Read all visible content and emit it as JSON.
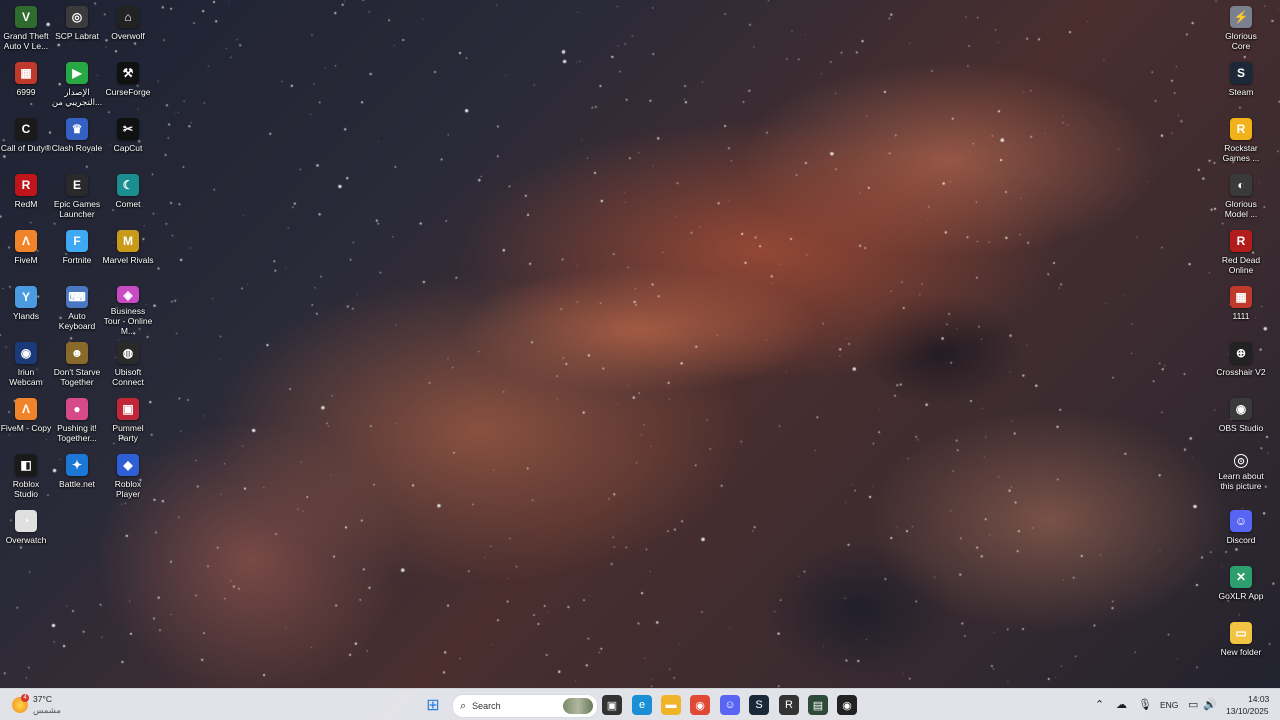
{
  "desktop": {
    "left_icons": [
      {
        "label": "Grand Theft Auto V Le...",
        "glyph": "V",
        "color": "#2f6b2f"
      },
      {
        "label": "SCP Labrat",
        "glyph": "◎",
        "color": "#3b3b3b"
      },
      {
        "label": "Overwolf",
        "glyph": "⌂",
        "color": "#222222"
      },
      {
        "label": "6999",
        "glyph": "▦",
        "color": "#c0392b"
      },
      {
        "label": "الإصدار التجريبي من...",
        "glyph": "▶",
        "color": "#27a844"
      },
      {
        "label": "CurseForge",
        "glyph": "⚒",
        "color": "#111111"
      },
      {
        "label": "Call of Duty®",
        "glyph": "C",
        "color": "#1a1a1a"
      },
      {
        "label": "Clash Royale",
        "glyph": "♛",
        "color": "#3460c4"
      },
      {
        "label": "CapCut",
        "glyph": "✂",
        "color": "#111111"
      },
      {
        "label": "RedM",
        "glyph": "R",
        "color": "#c0161b"
      },
      {
        "label": "Epic Games Launcher",
        "glyph": "E",
        "color": "#2a2a2a"
      },
      {
        "label": "Comet",
        "glyph": "☾",
        "color": "#1b8f8f"
      },
      {
        "label": "FiveM",
        "glyph": "Λ",
        "color": "#f0842a"
      },
      {
        "label": "Fortnite",
        "glyph": "F",
        "color": "#3fa9f5"
      },
      {
        "label": "Marvel Rivals",
        "glyph": "M",
        "color": "#c99a1a"
      },
      {
        "label": "Ylands",
        "glyph": "Y",
        "color": "#4a9be0"
      },
      {
        "label": "Auto Keyboard",
        "glyph": "⌨",
        "color": "#4a78c0"
      },
      {
        "label": "Business Tour - Online M...",
        "glyph": "◈",
        "color": "#c74bc2"
      },
      {
        "label": "Iriun Webcam",
        "glyph": "◉",
        "color": "#1b3a7a"
      },
      {
        "label": "Don't Starve Together",
        "glyph": "☻",
        "color": "#8a6a2a"
      },
      {
        "label": "Ubisoft Connect",
        "glyph": "◍",
        "color": "#2a2a2a"
      },
      {
        "label": "FiveM - Copy",
        "glyph": "Λ",
        "color": "#f0842a"
      },
      {
        "label": "Pushing it! Together...",
        "glyph": "●",
        "color": "#d64a8a"
      },
      {
        "label": "Pummel Party",
        "glyph": "▣",
        "color": "#c0283a"
      },
      {
        "label": "Roblox Studio",
        "glyph": "◧",
        "color": "#1a1a1a"
      },
      {
        "label": "Battle.net",
        "glyph": "✦",
        "color": "#1c78d6"
      },
      {
        "label": "Roblox Player",
        "glyph": "◆",
        "color": "#2f5fd6"
      },
      {
        "label": "Overwatch",
        "glyph": "◔",
        "color": "#e0e0e0"
      }
    ],
    "right_icons": [
      {
        "label": "Glorious Core",
        "glyph": "⚡",
        "color": "#7a8090"
      },
      {
        "label": "Steam",
        "glyph": "S",
        "color": "#1b2838"
      },
      {
        "label": "Rockstar Games ...",
        "glyph": "R",
        "color": "#f2b21c"
      },
      {
        "label": "Glorious Model ...",
        "glyph": "◐",
        "color": "#3a3a3a"
      },
      {
        "label": "Red Dead Online",
        "glyph": "R",
        "color": "#b31c1c"
      },
      {
        "label": "1111",
        "glyph": "▦",
        "color": "#c0392b"
      },
      {
        "label": "Crosshair V2",
        "glyph": "⊕",
        "color": "#222222"
      },
      {
        "label": "OBS Studio",
        "glyph": "◉",
        "color": "#3a3a3a"
      },
      {
        "label": "Learn about this picture",
        "glyph": "⊙",
        "color": "transparent"
      },
      {
        "label": "Discord",
        "glyph": "☺",
        "color": "#5865f2"
      },
      {
        "label": "GoXLR App",
        "glyph": "✕",
        "color": "#2d9f6f"
      },
      {
        "label": "New folder",
        "glyph": "▭",
        "color": "#f3c443"
      }
    ]
  },
  "taskbar": {
    "weather": {
      "temp": "37°C",
      "condition": "مشمس",
      "badge": "4"
    },
    "search_placeholder": "Search",
    "apps": [
      {
        "name": "start-button",
        "glyph": "⊞",
        "color": "#2b7de0"
      },
      {
        "name": "task-view",
        "glyph": "▣",
        "color": "#333333"
      },
      {
        "name": "edge",
        "glyph": "e",
        "color": "#1a8fd6"
      },
      {
        "name": "file-explorer",
        "glyph": "▬",
        "color": "#f0b429"
      },
      {
        "name": "chrome",
        "glyph": "◉",
        "color": "#e04a35"
      },
      {
        "name": "discord",
        "glyph": "☺",
        "color": "#5865f2"
      },
      {
        "name": "steam",
        "glyph": "S",
        "color": "#1b2838"
      },
      {
        "name": "rockstar",
        "glyph": "R",
        "color": "#333333"
      },
      {
        "name": "terminal",
        "glyph": "▤",
        "color": "#2d4a3a"
      },
      {
        "name": "obs",
        "glyph": "◉",
        "color": "#222222"
      }
    ],
    "language": "ENG",
    "time": "14:03",
    "date": "13/10/2025"
  }
}
